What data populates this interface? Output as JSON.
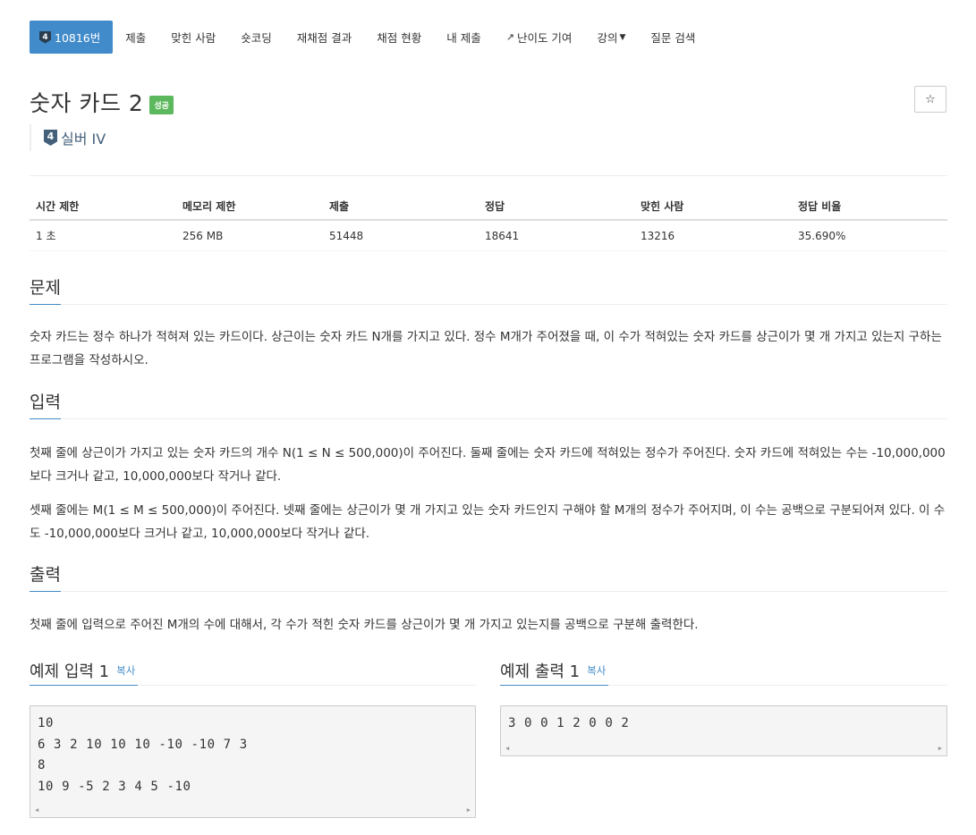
{
  "tabs": [
    {
      "label": "10816번",
      "tier": "4",
      "active": true
    },
    {
      "label": "제출"
    },
    {
      "label": "맞힌 사람"
    },
    {
      "label": "숏코딩"
    },
    {
      "label": "재채점 결과"
    },
    {
      "label": "채점 현황"
    },
    {
      "label": "내 제출"
    },
    {
      "label": "난이도 기여",
      "icon": "external-link-icon"
    },
    {
      "label": "강의",
      "icon": "caret-down-icon"
    },
    {
      "label": "질문 검색"
    }
  ],
  "problem": {
    "title": "숫자 카드 2",
    "status_badge": "성공",
    "tier_number": "4",
    "tier_label": "실버 IV",
    "star_icon": "☆"
  },
  "stats": {
    "headers": [
      "시간 제한",
      "메모리 제한",
      "제출",
      "정답",
      "맞힌 사람",
      "정답 비율"
    ],
    "values": [
      "1 초",
      "256 MB",
      "51448",
      "18641",
      "13216",
      "35.690%"
    ]
  },
  "sections": {
    "description": {
      "heading": "문제",
      "text": "숫자 카드는 정수 하나가 적혀져 있는 카드이다. 상근이는 숫자 카드 N개를 가지고 있다. 정수 M개가 주어졌을 때, 이 수가 적혀있는 숫자 카드를 상근이가 몇 개 가지고 있는지 구하는 프로그램을 작성하시오."
    },
    "input": {
      "heading": "입력",
      "p1": "첫째 줄에 상근이가 가지고 있는 숫자 카드의 개수 N(1 ≤ N ≤ 500,000)이 주어진다. 둘째 줄에는 숫자 카드에 적혀있는 정수가 주어진다. 숫자 카드에 적혀있는 수는 -10,000,000보다 크거나 같고, 10,000,000보다 작거나 같다.",
      "p2": "셋째 줄에는 M(1 ≤ M ≤ 500,000)이 주어진다. 넷째 줄에는 상근이가 몇 개 가지고 있는 숫자 카드인지 구해야 할 M개의 정수가 주어지며, 이 수는 공백으로 구분되어져 있다. 이 수도 -10,000,000보다 크거나 같고, 10,000,000보다 작거나 같다."
    },
    "output": {
      "heading": "출력",
      "text": "첫째 줄에 입력으로 주어진 M개의 수에 대해서, 각 수가 적힌 숫자 카드를 상근이가 몇 개 가지고 있는지를 공백으로 구분해 출력한다."
    }
  },
  "samples": {
    "input": {
      "heading": "예제 입력 1",
      "copy": "복사",
      "lines": [
        "10",
        "6 3 2 10 10 10 -10 -10 7 3",
        "8",
        "10 9 -5 2 3 4 5 -10"
      ]
    },
    "output": {
      "heading": "예제 출력 1",
      "copy": "복사",
      "lines": [
        "3 0 0 1 2 0 0 2"
      ]
    }
  }
}
